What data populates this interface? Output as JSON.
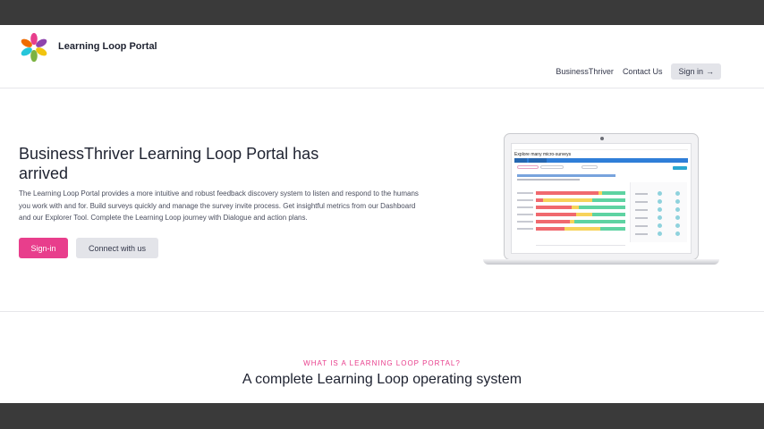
{
  "header": {
    "brand": "Learning Loop Portal",
    "nav": {
      "link1": "BusinessThriver",
      "link2": "Contact Us",
      "signin": "Sign in",
      "signin_arrow": "→"
    }
  },
  "hero": {
    "title": "BusinessThriver Learning Loop Portal has arrived",
    "text": "The Learning Loop Portal provides a more intuitive and robust feedback discovery system to listen and respond to the humans you work with and for. Build surveys quickly and manage the survey invite process. Get insightful metrics from our Dashboard and our Explorer Tool. Complete the Learning Loop journey with Dialogue and action plans.",
    "primary_button": "Sign-in",
    "secondary_button": "Connect with us"
  },
  "screenshot": {
    "title": "Explore many micro-surveys"
  },
  "section": {
    "eyebrow": "WHAT IS A LEARNING LOOP PORTAL?",
    "title": "A complete Learning Loop operating system"
  },
  "colors": {
    "accent": "#e83e8c",
    "neutral_button": "#e3e4e9",
    "red": "#f0696e",
    "yellow": "#f7d35a",
    "green": "#5ed3a2"
  }
}
